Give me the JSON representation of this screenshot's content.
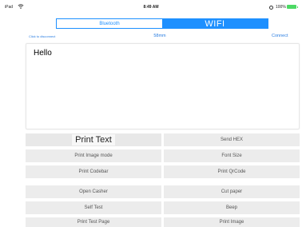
{
  "status_bar": {
    "device": "iPad",
    "time": "8:49 AM",
    "battery": "100%"
  },
  "segment": {
    "bluetooth": "Bluetooth",
    "wifi": "WIFI",
    "selected": "WIFI",
    "accent_color": "#1e90ff"
  },
  "info": {
    "disconnect": "Click to disconnect",
    "paper_size": "58mm",
    "connect": "Connect"
  },
  "editor": {
    "text": "Hello"
  },
  "buttons": {
    "print_text": "Print Text",
    "send_hex": "Send HEX",
    "print_image_mode": "Print Image mode",
    "font_size": "Font Size",
    "print_codebar": "Print Codebar",
    "print_qrcode": "Print QrCode",
    "open_casher": "Open Casher",
    "cut_paper": "Cut paper",
    "self_test": "Self Test",
    "beep": "Beep",
    "print_test_page": "Print Test Page",
    "print_image": "Print Image"
  }
}
